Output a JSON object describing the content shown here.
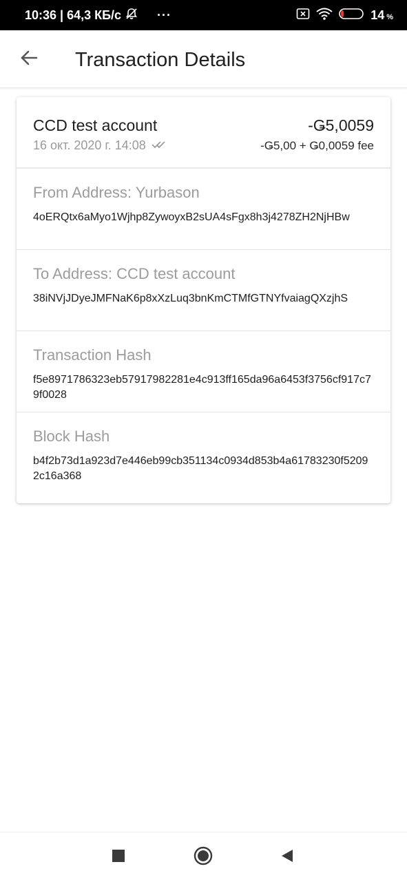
{
  "status_bar": {
    "time_speed": "10:36 | 64,3 КБ/с",
    "icons": [
      "alarm-off-icon",
      "more-dots-icon",
      "sim-x-icon",
      "wifi-icon",
      "battery-icon"
    ],
    "overflow": "···",
    "battery_value": "14",
    "battery_unit": "%",
    "battery_level_fraction": 0.14,
    "battery_low_color": "#e53935"
  },
  "app_bar": {
    "title": "Transaction Details",
    "back_icon": "arrow-left-icon"
  },
  "transaction": {
    "account_name": "CCD test account",
    "date": "16 окт. 2020 г. 14:08",
    "status_icon": "double-check-icon",
    "amount": "-Ǥ5,0059",
    "breakdown": "-Ǥ5,00 + Ǥ0,0059 fee"
  },
  "details": {
    "from_label": "From Address: Yurbason",
    "from_value": "4oERQtx6aMyo1Wjhp8ZywoyxB2sUA4sFgx8h3j4278ZH2NjHBw",
    "to_label": "To Address: CCD test account",
    "to_value": "38iNVjJDyeJMFNaK6p8xXzLuq3bnKmCTMfGTNYfvaiagQXzjhS",
    "tx_hash_label": "Transaction Hash",
    "tx_hash_value": "f5e8971786323eb57917982281e4c913ff165da96a6453f3756cf917c79f0028",
    "block_hash_label": "Block Hash",
    "block_hash_value": "b4f2b73d1a923d7e446eb99cb351134c0934d853b4a61783230f52092c16a368"
  },
  "nav_bar": {
    "buttons": [
      "recents-square-icon",
      "home-circle-icon",
      "back-triangle-icon"
    ]
  },
  "colors": {
    "status_bar_bg": "#000000",
    "label_gray": "#9c9c9c",
    "text_dark": "#1e1e1e"
  }
}
